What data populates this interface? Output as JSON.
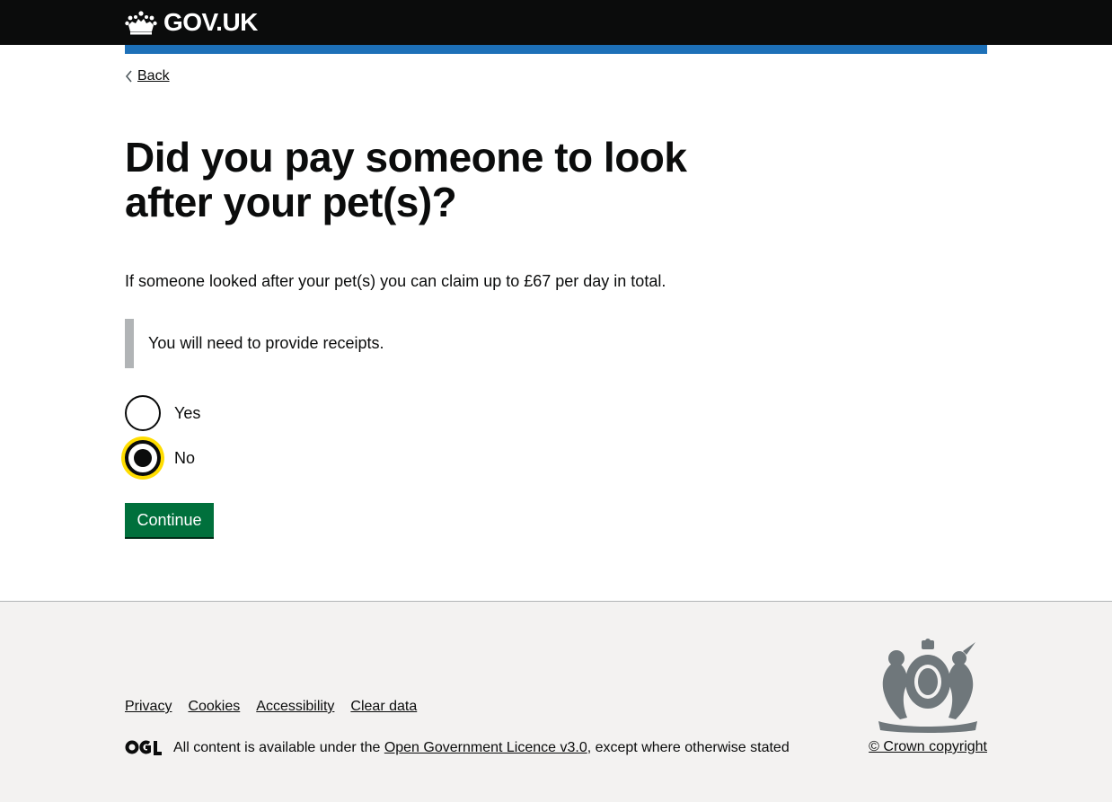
{
  "header": {
    "logo_text": "GOV.UK",
    "logo_icon": "crown-icon",
    "colors": {
      "background": "#0b0c0c",
      "accent_bar": "#1d70b8"
    }
  },
  "back_link": {
    "label": "Back",
    "icon": "chevron-left-icon"
  },
  "question": {
    "heading": "Did you pay someone to look after your pet(s)?",
    "hint": "If someone looked after your pet(s) you can claim up to £67 per day in total.",
    "inset": "You will need to provide receipts.",
    "options": [
      {
        "label": "Yes",
        "selected": false
      },
      {
        "label": "No",
        "selected": true
      }
    ]
  },
  "continue_button": {
    "label": "Continue",
    "color": "#00703c"
  },
  "footer": {
    "links": [
      {
        "label": "Privacy"
      },
      {
        "label": "Cookies"
      },
      {
        "label": "Accessibility"
      },
      {
        "label": "Clear data"
      }
    ],
    "ogl_icon": "ogl-logo-icon",
    "licence_prefix": "All content is available under the ",
    "licence_link": "Open Government Licence v3.0",
    "licence_suffix": ", except where otherwise stated",
    "crest_icon": "royal-coat-of-arms-icon",
    "copyright": "© Crown copyright",
    "background": "#f3f2f1"
  }
}
